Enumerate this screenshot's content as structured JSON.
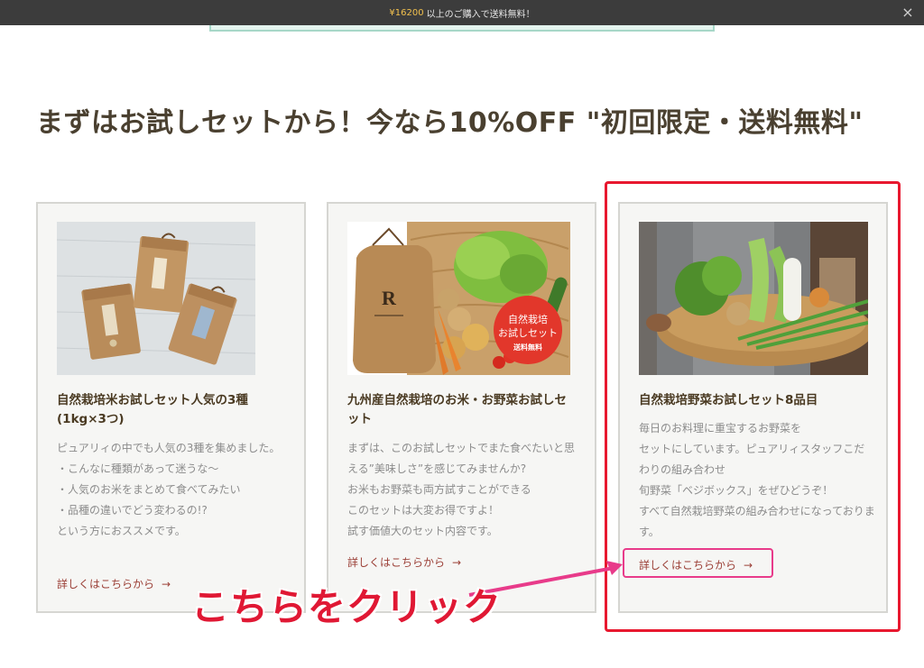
{
  "notice": {
    "amount": "¥16200",
    "message": "以上のご購入で送料無料！",
    "close_icon": "close-icon"
  },
  "section": {
    "title": "まずはお試しセットから！今なら10%OFF \"初回限定・送料無料\""
  },
  "cards": [
    {
      "title": "自然栽培米お試しセット人気の3種(1kg×3つ)",
      "body": [
        "ピュアリィの中でも人気の3種を集めました。",
        "・こんなに種類があって迷うな〜",
        "・人気のお米をまとめて食べてみたい",
        "・品種の違いでどう変わるの!?",
        "という方におススメです。"
      ],
      "link_label": "詳しくはこちらから",
      "link_icon": "arrow-right-icon"
    },
    {
      "title": "九州産自然栽培のお米・お野菜お試しセット",
      "body": [
        "まずは、このお試しセットでまた食べたいと思える”美味しさ”を感じてみませんか?",
        "お米もお野菜も両方試すことができる",
        "このセットは大変お得ですよ！",
        "試す価値大のセット内容です。"
      ],
      "image_badge": [
        "自然栽培",
        "お試しセット",
        "送料無料"
      ],
      "link_label": "詳しくはこちらから",
      "link_icon": "arrow-right-icon"
    },
    {
      "title": "自然栽培野菜お試しセット8品目",
      "body": [
        "毎日のお料理に重宝するお野菜を",
        "セットにしています。ピュアリィスタッフこだわりの組み合わせ",
        "旬野菜「ベジボックス」をぜひどうぞ！",
        "すべて自然栽培野菜の組み合わせになっております。"
      ],
      "link_label": "詳しくはこちらから",
      "link_icon": "arrow-right-icon"
    }
  ],
  "annotation": {
    "callout": "こちらをクリック",
    "color": "#e01834"
  }
}
